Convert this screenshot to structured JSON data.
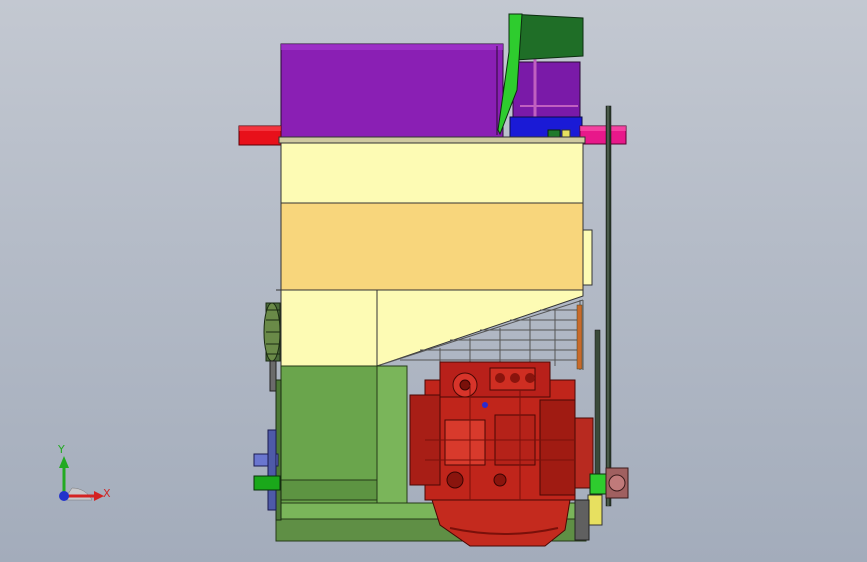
{
  "app": {
    "view": "front-orthographic",
    "window_title": ""
  },
  "triad": {
    "x_label": "X",
    "y_label": "Y",
    "x_color": "#d42222",
    "y_color": "#22aa22",
    "z_color": "#2233cc"
  },
  "model": {
    "parts": [
      {
        "name": "hopper",
        "color": "#8a1fb4"
      },
      {
        "name": "feed-chute",
        "color": "#1f7a2a"
      },
      {
        "name": "upper-housing",
        "color": "#fdfbb4"
      },
      {
        "name": "middle-housing",
        "color": "#f8d67c"
      },
      {
        "name": "lower-housing",
        "color": "#fdfbb4"
      },
      {
        "name": "base-frame",
        "color": "#6aa54c"
      },
      {
        "name": "engine",
        "color": "#c0251b"
      },
      {
        "name": "left-shaft",
        "color": "#e8101a"
      },
      {
        "name": "right-shaft",
        "color": "#e8188a"
      },
      {
        "name": "support-rod",
        "color": "#2b3a2b"
      }
    ]
  }
}
